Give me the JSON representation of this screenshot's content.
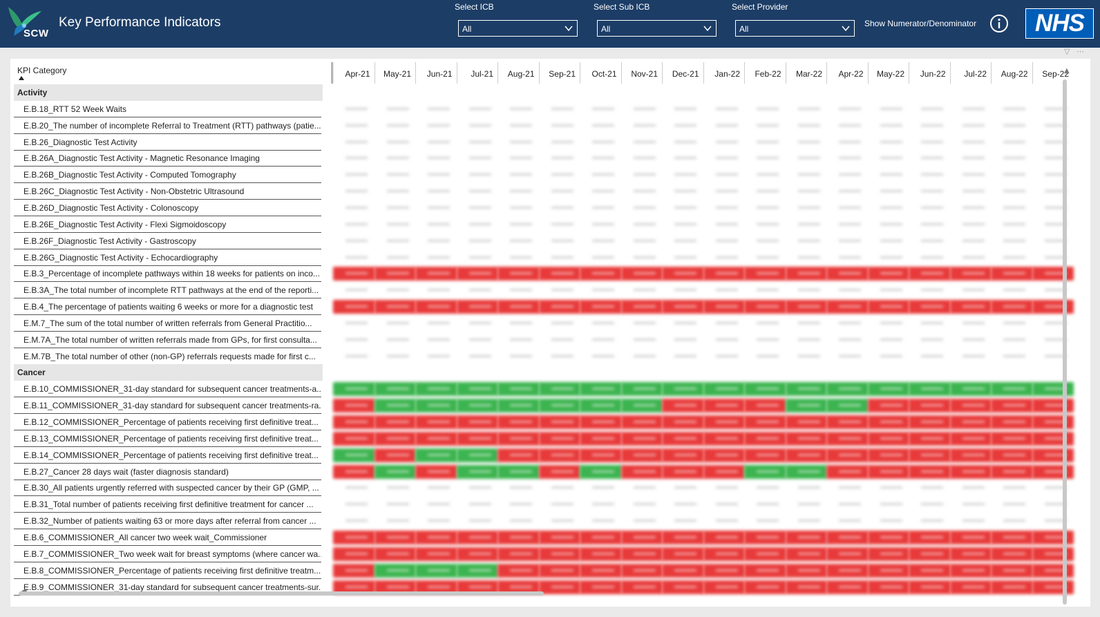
{
  "header": {
    "logo_text": "SCW",
    "title": "Key Performance Indicators",
    "filters": [
      {
        "label": "Select ICB",
        "value": "All"
      },
      {
        "label": "Select Sub ICB",
        "value": "All"
      },
      {
        "label": "Select Provider",
        "value": "All"
      }
    ],
    "toggle_label": "Show Numerator/Denominator",
    "nhs_logo": "NHS"
  },
  "matrix": {
    "row_header": "KPI Category",
    "months": [
      "Apr-21",
      "May-21",
      "Jun-21",
      "Jul-21",
      "Aug-21",
      "Sep-21",
      "Oct-21",
      "Nov-21",
      "Dec-21",
      "Jan-22",
      "Feb-22",
      "Mar-22",
      "Apr-22",
      "May-22",
      "Jun-22",
      "Jul-22",
      "Aug-22",
      "Sep-22"
    ],
    "rows": [
      {
        "type": "group",
        "label": "Activity"
      },
      {
        "type": "kpi",
        "label": "E.B.18_RTT 52 Week Waits",
        "status": "nnnnnnnnnnnnnnnnnn"
      },
      {
        "type": "kpi",
        "label": "E.B.20_The number of incomplete Referral to Treatment (RTT) pathways (patie...",
        "status": "nnnnnnnnnnnnnnnnnn"
      },
      {
        "type": "kpi",
        "label": "E.B.26_Diagnostic Test Activity",
        "status": "nnnnnnnnnnnnnnnnnn"
      },
      {
        "type": "kpi",
        "label": "E.B.26A_Diagnostic Test Activity - Magnetic Resonance Imaging",
        "status": "nnnnnnnnnnnnnnnnnn"
      },
      {
        "type": "kpi",
        "label": "E.B.26B_Diagnostic Test Activity - Computed Tomography",
        "status": "nnnnnnnnnnnnnnnnnn"
      },
      {
        "type": "kpi",
        "label": "E.B.26C_Diagnostic Test Activity - Non-Obstetric Ultrasound",
        "status": "nnnnnnnnnnnnnnnnnn"
      },
      {
        "type": "kpi",
        "label": "E.B.26D_Diagnostic Test Activity - Colonoscopy",
        "status": "nnnnnnnnnnnnnnnnnn"
      },
      {
        "type": "kpi",
        "label": "E.B.26E_Diagnostic Test Activity - Flexi Sigmoidoscopy",
        "status": "nnnnnnnnnnnnnnnnnn"
      },
      {
        "type": "kpi",
        "label": "E.B.26F_Diagnostic Test Activity - Gastroscopy",
        "status": "nnnnnnnnnnnnnnnnnn"
      },
      {
        "type": "kpi",
        "label": "E.B.26G_Diagnostic Test Activity - Echocardiography",
        "status": "nnnnnnnnnnnnnnnnnn"
      },
      {
        "type": "kpi",
        "label": "E.B.3_Percentage of incomplete pathways within 18 weeks for patients on inco...",
        "status": "rrrrrrrrrrrrrrrrrr"
      },
      {
        "type": "kpi",
        "label": "E.B.3A_The total number of incomplete RTT pathways at the end of the reporti...",
        "status": "nnnnnnnnnnnnnnnnnn"
      },
      {
        "type": "kpi",
        "label": "E.B.4_The percentage of patients waiting 6 weeks or more for a diagnostic test",
        "status": "rrrrrrrrrrrrrrrrrr"
      },
      {
        "type": "kpi",
        "label": "E.M.7_The sum of the total number of written referrals from General Practitio...",
        "status": "nnnnnnnnnnnnnnnnnn"
      },
      {
        "type": "kpi",
        "label": "E.M.7A_The total number of written referrals made from GPs, for first consulta...",
        "status": "nnnnnnnnnnnnnnnnnn"
      },
      {
        "type": "kpi",
        "label": "E.M.7B_The total number of other (non-GP) referrals requests made for first c...",
        "status": "nnnnnnnnnnnnnnnnnn"
      },
      {
        "type": "group",
        "label": "Cancer"
      },
      {
        "type": "kpi",
        "label": "E.B.10_COMMISSIONER_31-day standard for subsequent cancer treatments-a...",
        "status": "gggggggggggggggggg"
      },
      {
        "type": "kpi",
        "label": "E.B.11_COMMISSIONER_31-day standard for subsequent cancer treatments-ra...",
        "status": "rgggggggrrrggrrrrr"
      },
      {
        "type": "kpi",
        "label": "E.B.12_COMMISSIONER_Percentage of patients receiving first definitive treat...",
        "status": "rrrrrrrrrrrrrrrrrr"
      },
      {
        "type": "kpi",
        "label": "E.B.13_COMMISSIONER_Percentage of patients receiving first definitive treat...",
        "status": "rrrrrrrrrrrrrrrrrr"
      },
      {
        "type": "kpi",
        "label": "E.B.14_COMMISSIONER_Percentage of patients receiving first definitive treat...",
        "status": "grggrrrrrrrrrrrrrr"
      },
      {
        "type": "kpi",
        "label": "E.B.27_Cancer 28 days wait (faster diagnosis standard)",
        "status": "rgrggrgrrrggrrrrrr"
      },
      {
        "type": "kpi",
        "label": "E.B.30_All patients urgently referred with suspected cancer by their GP (GMP, ...",
        "status": "nnnnnnnnnnnnnnnnnn"
      },
      {
        "type": "kpi",
        "label": "E.B.31_Total number of patients receiving first definitive treatment for cancer ...",
        "status": "nnnnnnnnnnnnnnnnnn"
      },
      {
        "type": "kpi",
        "label": "E.B.32_Number of patients waiting 63 or more days after referral from cancer ...",
        "status": "nnnnnnnnnnnnnnnnnn"
      },
      {
        "type": "kpi",
        "label": "E.B.6_COMMISSIONER_All cancer two week wait_Commissioner",
        "status": "rrrrrrrrrrrrrrrrrr"
      },
      {
        "type": "kpi",
        "label": "E.B.7_COMMISSIONER_Two week wait for breast symptoms (where cancer wa...",
        "status": "rrrrrrrrrrrrrrrrrr"
      },
      {
        "type": "kpi",
        "label": "E.B.8_COMMISSIONER_Percentage of patients receiving first definitive treatm...",
        "status": "rgggrrrrrrrrrrrrrr"
      },
      {
        "type": "kpi",
        "label": "E.B.9_COMMISSIONER_31-day standard for subsequent cancer treatments-sur...",
        "status": "rrrrrrrrrrrrrrrrrr"
      }
    ]
  },
  "colors": {
    "header_bg": "#1c3d66",
    "red": "#e83a3a",
    "green": "#3cb44f",
    "nhs_blue": "#005eb8"
  }
}
